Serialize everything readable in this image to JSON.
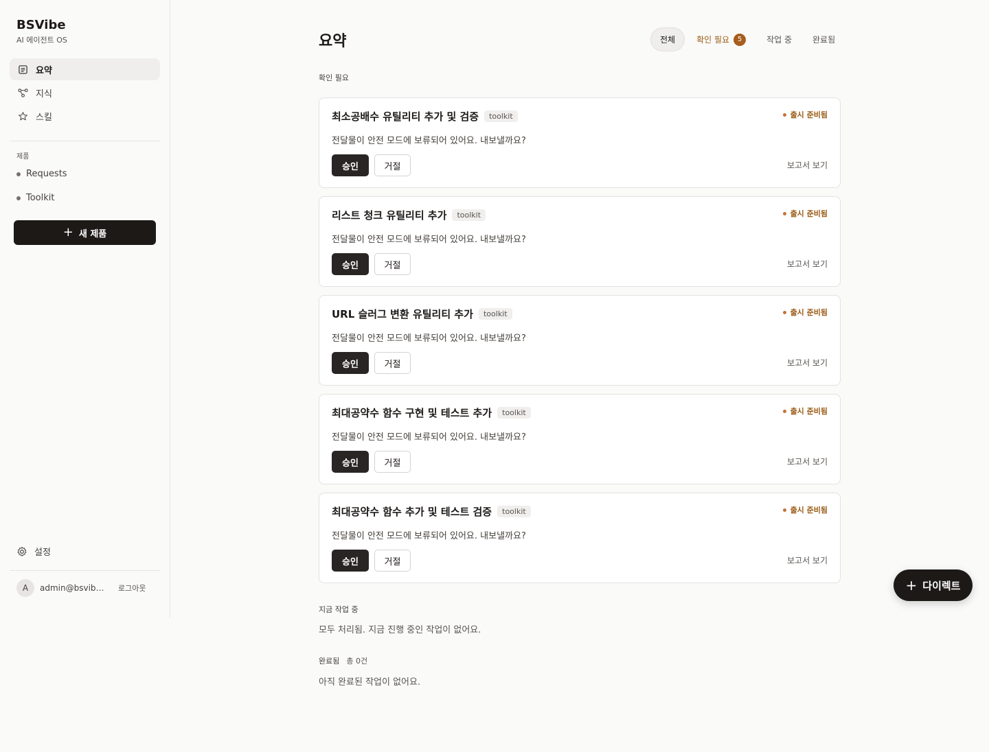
{
  "sidebar": {
    "brand_title": "BSVibe",
    "brand_subtitle": "AI 에이전트 OS",
    "nav": [
      {
        "label": "요약",
        "icon": "summary-icon",
        "active": true
      },
      {
        "label": "지식",
        "icon": "graph-icon",
        "active": false
      },
      {
        "label": "스킬",
        "icon": "star-icon",
        "active": false
      }
    ],
    "products_label": "제품",
    "products": [
      "Requests",
      "Toolkit"
    ],
    "new_product": "새 제품",
    "settings": "설정",
    "user_initial": "A",
    "user_email": "admin@bsvibe.dev",
    "logout": "로그아웃"
  },
  "header": {
    "title": "요약",
    "tabs": [
      {
        "label": "전체",
        "active": true
      },
      {
        "label": "확인 필요",
        "badge": "5"
      },
      {
        "label": "작업 중"
      },
      {
        "label": "완료됨"
      }
    ]
  },
  "needs_review": {
    "label": "확인 필요",
    "cards": [
      {
        "title": "최소공배수 유틸리티 추가 및 검증",
        "tag": "toolkit",
        "status": "출시 준비됨",
        "desc": "전달물이 안전 모드에 보류되어 있어요. 내보낼까요?",
        "approve": "승인",
        "reject": "거절",
        "report": "보고서 보기"
      },
      {
        "title": "리스트 청크 유틸리티 추가",
        "tag": "toolkit",
        "status": "출시 준비됨",
        "desc": "전달물이 안전 모드에 보류되어 있어요. 내보낼까요?",
        "approve": "승인",
        "reject": "거절",
        "report": "보고서 보기"
      },
      {
        "title": "URL 슬러그 변환 유틸리티 추가",
        "tag": "toolkit",
        "status": "출시 준비됨",
        "desc": "전달물이 안전 모드에 보류되어 있어요. 내보낼까요?",
        "approve": "승인",
        "reject": "거절",
        "report": "보고서 보기"
      },
      {
        "title": "최대공약수 함수 구현 및 테스트 추가",
        "tag": "toolkit",
        "status": "출시 준비됨",
        "desc": "전달물이 안전 모드에 보류되어 있어요. 내보낼까요?",
        "approve": "승인",
        "reject": "거절",
        "report": "보고서 보기"
      },
      {
        "title": "최대공약수 함수 추가 및 테스트 검증",
        "tag": "toolkit",
        "status": "출시 준비됨",
        "desc": "전달물이 안전 모드에 보류되어 있어요. 내보낼까요?",
        "approve": "승인",
        "reject": "거절",
        "report": "보고서 보기"
      }
    ]
  },
  "in_progress": {
    "label": "지금 작업 중",
    "empty": "모두 처리됨. 지금 진행 중인 작업이 없어요."
  },
  "completed": {
    "label": "완료됨",
    "count": "총 0건",
    "empty": "아직 완료된 작업이 없어요."
  },
  "fab": {
    "label": "다이렉트"
  },
  "colors": {
    "accent": "#9a5b14",
    "badge": "#a75d1e",
    "dark": "#1c1917"
  }
}
